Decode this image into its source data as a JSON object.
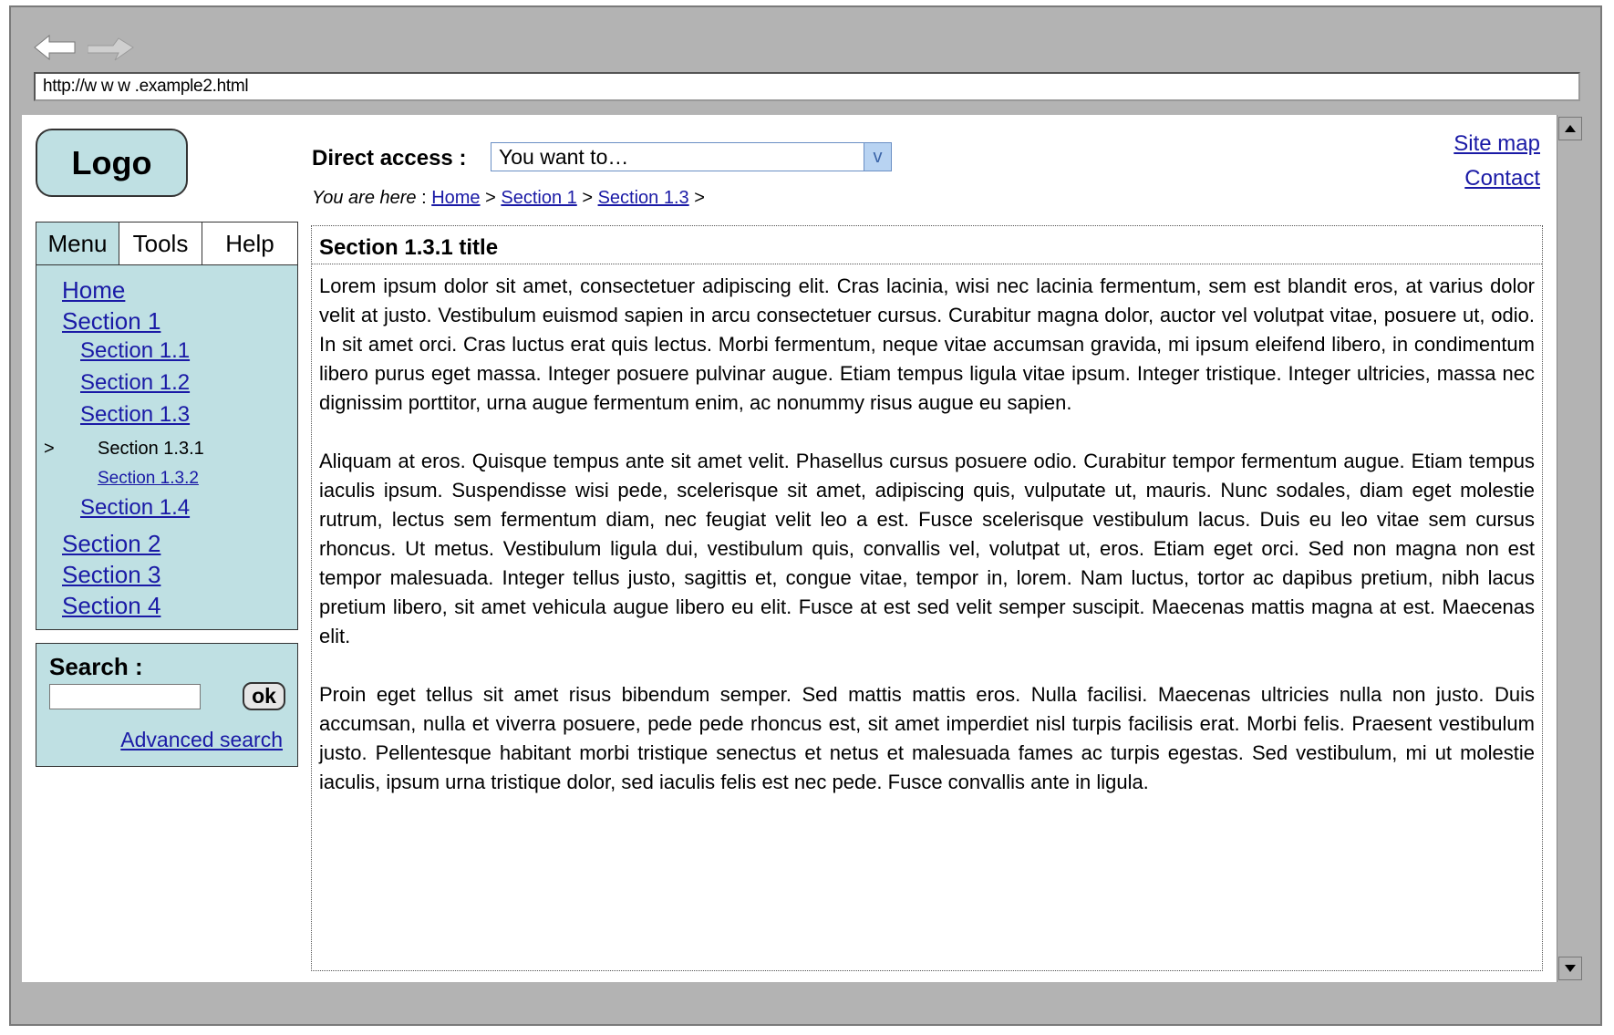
{
  "browser": {
    "url": "http://w w w .example2.html"
  },
  "header": {
    "logo": "Logo",
    "direct_access_label": "Direct access :",
    "direct_access_value": "You want to…",
    "direct_access_button": "v",
    "breadcrumb": {
      "prefix": "You are here",
      "sep": " : ",
      "items": [
        "Home",
        "Section 1",
        "Section 1.3"
      ],
      "arrow": ">"
    },
    "links": {
      "site_map": "Site map",
      "contact": "Contact"
    }
  },
  "sidebar": {
    "tabs": [
      "Menu",
      "Tools",
      "Help"
    ],
    "active_tab": "Menu",
    "current_marker": ">",
    "menu_items": [
      {
        "label": "Home",
        "level": 1,
        "current": false
      },
      {
        "label": "Section 1",
        "level": 1,
        "current": false
      },
      {
        "label": "Section 1.1",
        "level": 2,
        "current": false
      },
      {
        "label": "Section 1.2",
        "level": 2,
        "current": false
      },
      {
        "label": "Section 1.3",
        "level": 2,
        "current": false
      },
      {
        "label": "Section 1.3.1",
        "level": 3,
        "current": true
      },
      {
        "label": "Section 1.3.2",
        "level": 3,
        "current": false
      },
      {
        "label": "Section 1.4",
        "level": 2,
        "current": false
      },
      {
        "label": "Section 2",
        "level": 1,
        "current": false
      },
      {
        "label": "Section 3",
        "level": 1,
        "current": false
      },
      {
        "label": "Section 4",
        "level": 1,
        "current": false
      }
    ],
    "search": {
      "label": "Search :",
      "value": "",
      "button": "ok",
      "advanced": "Advanced search"
    }
  },
  "content": {
    "title": "Section 1.3.1 title",
    "paragraphs": [
      "Lorem ipsum dolor sit amet, consectetuer adipiscing elit. Cras lacinia, wisi nec lacinia fermentum, sem est blandit eros, at varius dolor velit at justo. Vestibulum euismod sapien in arcu consectetuer cursus. Curabitur magna dolor, auctor vel volutpat vitae, posuere ut, odio. In sit amet orci. Cras luctus erat quis lectus. Morbi fermentum, neque vitae accumsan gravida, mi ipsum eleifend libero, in condimentum libero purus eget massa. Integer posuere pulvinar augue. Etiam tempus ligula vitae ipsum. Integer tristique. Integer ultricies, massa nec dignissim porttitor, urna augue fermentum enim, ac nonummy risus augue eu sapien.",
      "Aliquam at eros. Quisque tempus ante sit amet velit. Phasellus cursus posuere odio. Curabitur tempor fermentum augue. Etiam tempus iaculis ipsum. Suspendisse wisi pede, scelerisque sit amet, adipiscing quis, vulputate ut, mauris. Nunc sodales, diam eget molestie rutrum, lectus sem fermentum diam, nec feugiat velit leo a est. Fusce scelerisque vestibulum lacus. Duis eu leo vitae sem cursus rhoncus. Ut metus. Vestibulum ligula dui, vestibulum quis, convallis vel, volutpat ut, eros. Etiam eget orci. Sed non magna non est tempor malesuada. Integer tellus justo, sagittis et, congue vitae, tempor in, lorem. Nam luctus, tortor ac dapibus pretium, nibh lacus pretium libero, sit amet vehicula augue libero eu elit. Fusce at est sed velit semper suscipit. Maecenas mattis magna at est. Maecenas elit.",
      "Proin eget tellus sit amet risus bibendum semper. Sed mattis mattis eros. Nulla facilisi. Maecenas ultricies nulla non justo. Duis accumsan, nulla et viverra posuere, pede pede rhoncus est, sit amet imperdiet nisl turpis facilisis erat. Morbi felis. Praesent vestibulum justo. Pellentesque habitant morbi tristique senectus et netus et malesuada fames ac turpis egestas. Sed vestibulum, mi ut molestie iaculis, ipsum urna tristique dolor, sed iaculis felis est nec pede. Fusce convallis ante in ligula."
    ]
  },
  "colors": {
    "panel": "#bfe0e3",
    "chrome": "#b3b3b3",
    "link": "#1a1aa6"
  },
  "icons": [
    "back-arrow-icon",
    "forward-arrow-icon",
    "scroll-up-icon",
    "scroll-down-icon",
    "dropdown-icon"
  ]
}
